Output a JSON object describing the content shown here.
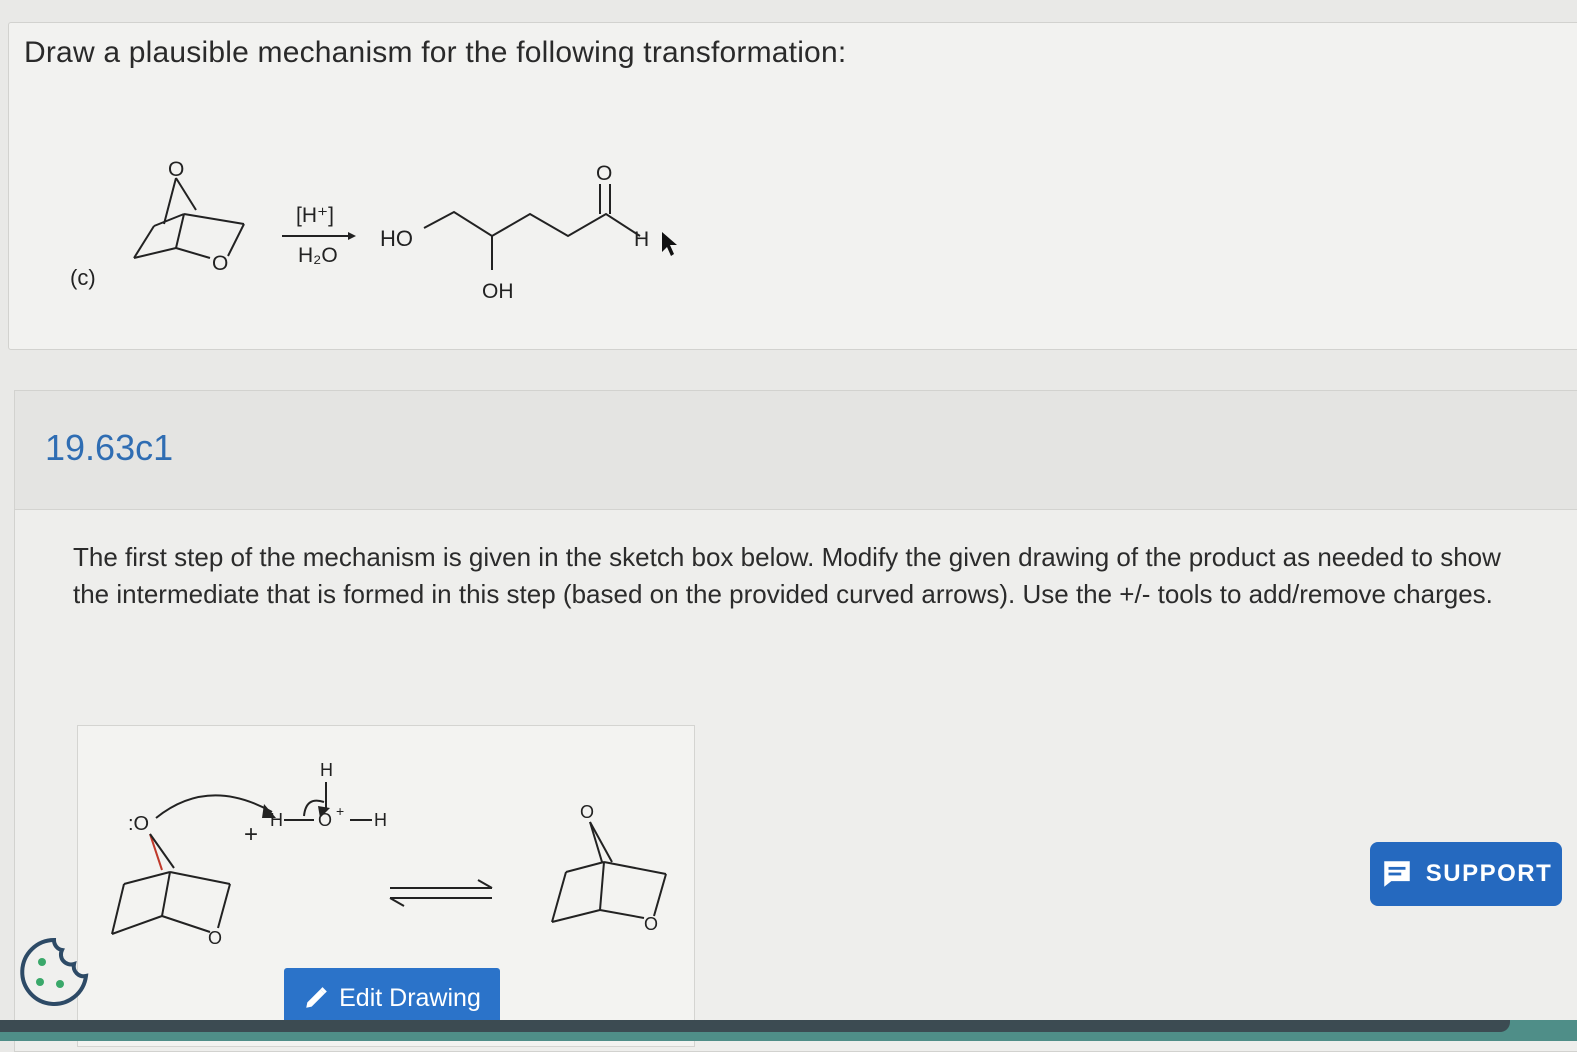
{
  "question": {
    "title": "Draw a plausible mechanism for the following transformation:",
    "part_label": "(c)",
    "reagent_top": "[H⁺]",
    "reagent_bottom": "H₂O",
    "product_labels": {
      "ho": "HO",
      "oh": "OH",
      "o": "O",
      "h": "H"
    },
    "reactant_labels": {
      "o_top": "O",
      "o_ring": "O"
    }
  },
  "part": {
    "id": "19.63c1",
    "instructions": "The first step of the mechanism is given in the sketch box below. Modify the given drawing of the product as needed to show the intermediate that is formed in this step (based on the provided curved arrows). Use the +/- tools to add/remove charges."
  },
  "sketch": {
    "lone_pair_o": ":O",
    "plus": "+",
    "h_top": "H",
    "h_left": "H",
    "h_right": "H",
    "o_center": "O",
    "charge": "+",
    "o_ring_left": "O",
    "o_top_right": "O",
    "o_ring_right": "O"
  },
  "buttons": {
    "edit_drawing": "Edit Drawing",
    "support": "SUPPORT"
  },
  "icons": {
    "edit": "pencil-icon",
    "support": "chat-icon",
    "cookie": "cookie-icon"
  },
  "colors": {
    "accent": "#2b73c9",
    "part_id": "#2f6db3",
    "arrow_red": "#c0392b"
  }
}
